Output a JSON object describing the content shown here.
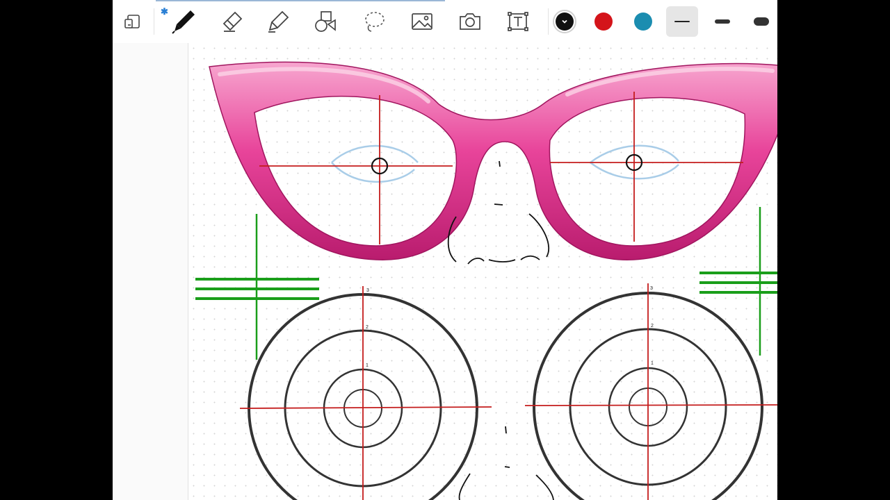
{
  "toolbar": {
    "tools": [
      {
        "name": "pages-icon",
        "state": "normal"
      },
      {
        "name": "pen-icon",
        "state": "active"
      },
      {
        "name": "eraser-icon",
        "state": "normal"
      },
      {
        "name": "highlighter-icon",
        "state": "normal"
      },
      {
        "name": "shapes-icon",
        "state": "normal"
      },
      {
        "name": "lasso-icon",
        "state": "normal"
      },
      {
        "name": "image-icon",
        "state": "normal"
      },
      {
        "name": "camera-icon",
        "state": "normal"
      },
      {
        "name": "text-box-icon",
        "state": "normal"
      }
    ],
    "bluetooth_symbol": "✱",
    "colors": [
      {
        "name": "black",
        "hex": "#111111",
        "selected": true
      },
      {
        "name": "red",
        "hex": "#d4141a",
        "selected": false
      },
      {
        "name": "teal",
        "hex": "#1b8db0",
        "selected": false
      }
    ],
    "stroke_widths": [
      "thin",
      "medium",
      "thick"
    ],
    "selected_stroke": "thin"
  },
  "canvas": {
    "background": "dotted-paper",
    "drawing": "cat-eye-glasses-and-target-circles",
    "accent_colors": {
      "frame": "#e8449a",
      "guide_lines": "#c41c1c",
      "eye_outline": "#a9cde8",
      "marks": "#1a9e1a"
    },
    "circle_labels": [
      "3",
      "2",
      "1"
    ]
  }
}
